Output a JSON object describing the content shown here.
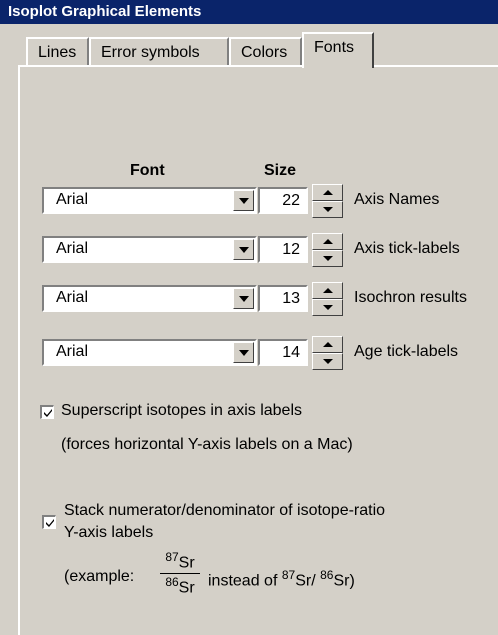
{
  "window": {
    "title": "Isoplot Graphical Elements"
  },
  "tabs": [
    {
      "label": "Lines"
    },
    {
      "label": "Error symbols"
    },
    {
      "label": "Colors"
    },
    {
      "label": "Fonts",
      "active": true
    }
  ],
  "headers": {
    "font": "Font",
    "size": "Size"
  },
  "rows": [
    {
      "font": "Arial",
      "size": "22",
      "label": "Axis Names"
    },
    {
      "font": "Arial",
      "size": "12",
      "label": "Axis tick-labels"
    },
    {
      "font": "Arial",
      "size": "13",
      "label": "Isochron results"
    },
    {
      "font": "Arial",
      "size": "14",
      "label": "Age tick-labels"
    }
  ],
  "superscript": {
    "label": "Superscript isotopes in axis labels",
    "note": "(forces horizontal Y-axis labels on a Mac)",
    "checked": true
  },
  "stack": {
    "label_line1": "Stack numerator/denominator of isotope-ratio",
    "label_line2": "Y-axis labels",
    "checked": true,
    "example_prefix": "(example:",
    "numerator_mass": "87",
    "numerator_element": "Sr",
    "denominator_mass": "86",
    "denominator_element": "Sr",
    "instead_of": "instead of",
    "alt_num_mass": "87",
    "alt_num_element": "Sr/",
    "alt_den_mass": "86",
    "alt_den_element": "Sr)"
  }
}
